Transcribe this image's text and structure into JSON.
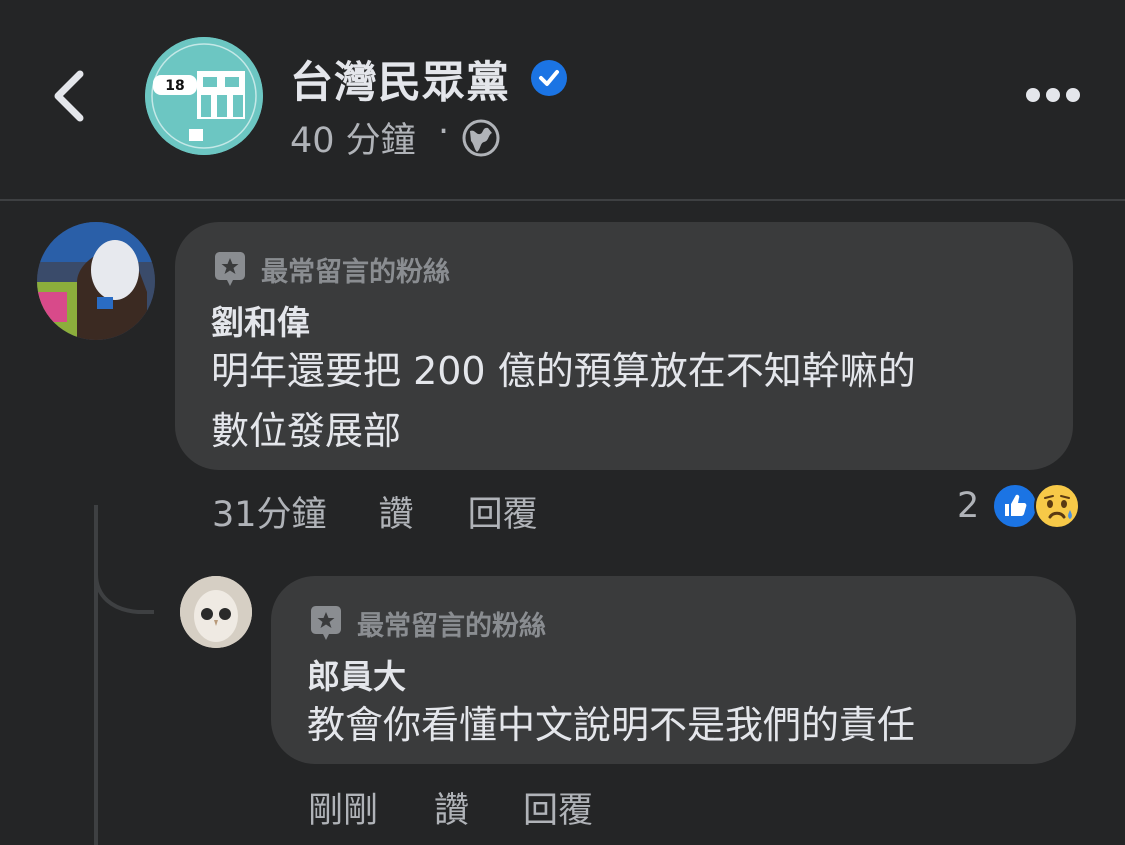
{
  "header": {
    "page_name": "台灣民眾黨",
    "post_time": "40 分鐘",
    "separator": "·",
    "avatar_badge": "18"
  },
  "comments": [
    {
      "badge": "最常留言的粉絲",
      "author": "劉和偉",
      "text_line1": "明年還要把 200 億的預算放在不知幹嘛的",
      "text_line2": "數位發展部",
      "time": "31分鐘",
      "like_label": "讚",
      "reply_label": "回覆",
      "reaction_count": "2"
    },
    {
      "badge": "最常留言的粉絲",
      "author": "郎員大",
      "text_line1": "教會你看懂中文說明不是我們的責任",
      "time": "剛剛",
      "like_label": "讚",
      "reply_label": "回覆"
    }
  ],
  "icons": {
    "back": "chevron-left-icon",
    "verified": "verified-badge-icon",
    "globe": "globe-icon",
    "more": "more-horizontal-icon",
    "badge": "top-fan-badge-icon",
    "like_reaction": "like-reaction-icon",
    "sad_reaction": "sad-reaction-icon"
  },
  "colors": {
    "background": "#242526",
    "bubble": "#3a3b3c",
    "primary_text": "#e4e6eb",
    "secondary_text": "#b0b3b8",
    "verified_blue": "#1b74e4",
    "avatar_teal": "#6cc6c2"
  }
}
